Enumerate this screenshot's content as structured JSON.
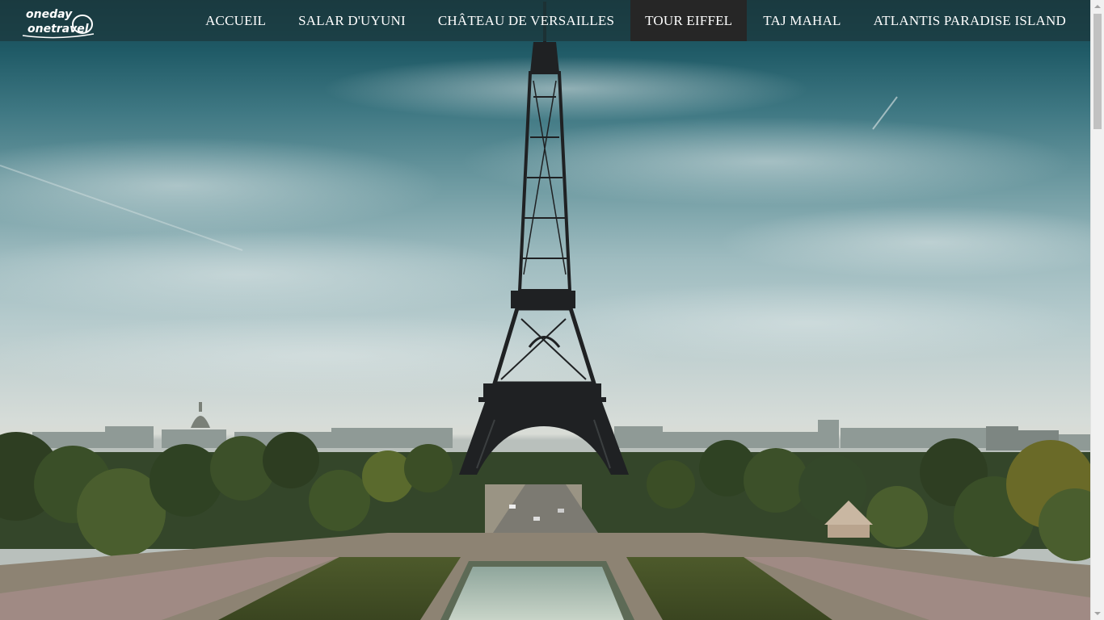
{
  "logo": {
    "line1": "oneday",
    "line2": "onetravel",
    "icon": "oneday-onetravel-logo-icon"
  },
  "nav": {
    "items": [
      {
        "label": "ACCUEIL",
        "active": false
      },
      {
        "label": "SALAR D'UYUNI",
        "active": false
      },
      {
        "label": "CHÂTEAU DE VERSAILLES",
        "active": false
      },
      {
        "label": "TOUR EIFFEL",
        "active": true
      },
      {
        "label": "TAJ MAHAL",
        "active": false
      },
      {
        "label": "ATLANTIS PARADISE ISLAND",
        "active": false
      }
    ]
  },
  "hero": {
    "subject": "eiffel-tower-image"
  },
  "colors": {
    "nav_background": "#1c373c",
    "active_item_background": "#262626",
    "nav_text": "#ffffff",
    "sky_top": "#16434d",
    "foliage": "#3f5a2a"
  }
}
